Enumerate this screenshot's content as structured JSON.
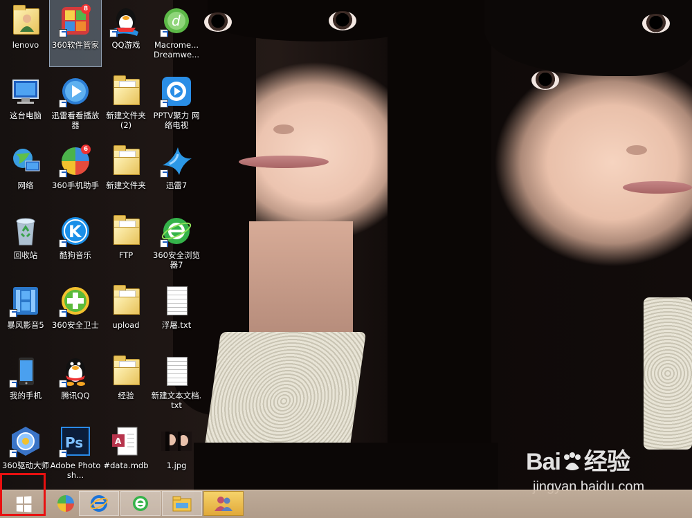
{
  "desktop": {
    "icons": [
      {
        "label": "lenovo",
        "icon": "user-folder-icon",
        "shortcut": false,
        "selected": false
      },
      {
        "label": "360软件管家",
        "icon": "360-software-manager-icon",
        "shortcut": true,
        "selected": true,
        "badge": "8"
      },
      {
        "label": "QQ游戏",
        "icon": "qq-game-icon",
        "shortcut": true,
        "selected": false
      },
      {
        "label": "Macrome... Dreamwe...",
        "icon": "dreamweaver-icon",
        "shortcut": true,
        "selected": false
      },
      {
        "label": "这台电脑",
        "icon": "computer-icon",
        "shortcut": false,
        "selected": false
      },
      {
        "label": "迅雷看看播放器",
        "icon": "xunlei-player-icon",
        "shortcut": true,
        "selected": false
      },
      {
        "label": "新建文件夹 (2)",
        "icon": "folder-icon",
        "shortcut": false,
        "selected": false
      },
      {
        "label": "PPTV聚力 网络电视",
        "icon": "pptv-icon",
        "shortcut": true,
        "selected": false
      },
      {
        "label": "网络",
        "icon": "network-icon",
        "shortcut": false,
        "selected": false
      },
      {
        "label": "360手机助手",
        "icon": "360-phone-assistant-icon",
        "shortcut": true,
        "selected": false,
        "badge": "6"
      },
      {
        "label": "新建文件夹",
        "icon": "folder-icon",
        "shortcut": false,
        "selected": false
      },
      {
        "label": "迅雷7",
        "icon": "xunlei-bird-icon",
        "shortcut": true,
        "selected": false
      },
      {
        "label": "回收站",
        "icon": "recycle-bin-icon",
        "shortcut": false,
        "selected": false
      },
      {
        "label": "酷狗音乐",
        "icon": "kugou-music-icon",
        "shortcut": true,
        "selected": false
      },
      {
        "label": "FTP",
        "icon": "folder-icon",
        "shortcut": false,
        "selected": false
      },
      {
        "label": "360安全浏览器7",
        "icon": "360-browser-icon",
        "shortcut": true,
        "selected": false
      },
      {
        "label": "暴风影音5",
        "icon": "baofeng-player-icon",
        "shortcut": true,
        "selected": false
      },
      {
        "label": "360安全卫士",
        "icon": "360-security-icon",
        "shortcut": true,
        "selected": false
      },
      {
        "label": "upload",
        "icon": "folder-icon",
        "shortcut": false,
        "selected": false
      },
      {
        "label": "浮屠.txt",
        "icon": "text-file-icon",
        "shortcut": false,
        "selected": false
      },
      {
        "label": "我的手机",
        "icon": "phone-icon",
        "shortcut": true,
        "selected": false
      },
      {
        "label": "腾讯QQ",
        "icon": "qq-penguin-icon",
        "shortcut": true,
        "selected": false
      },
      {
        "label": "经验",
        "icon": "folder-icon",
        "shortcut": false,
        "selected": false
      },
      {
        "label": "新建文本文档.txt",
        "icon": "text-file-icon",
        "shortcut": false,
        "selected": false
      },
      {
        "label": "360驱动大师",
        "icon": "360-driver-master-icon",
        "shortcut": true,
        "selected": false
      },
      {
        "label": "Adobe Photosh...",
        "icon": "photoshop-icon",
        "shortcut": true,
        "selected": false
      },
      {
        "label": "#data.mdb",
        "icon": "access-database-icon",
        "shortcut": false,
        "selected": false
      },
      {
        "label": "1.jpg",
        "icon": "image-thumbnail-icon",
        "shortcut": false,
        "selected": false
      }
    ]
  },
  "taskbar": {
    "start_icon": "windows-logo-icon",
    "items": [
      {
        "name": "pinwheel-app",
        "icon": "color-pinwheel-icon",
        "state": "normal"
      },
      {
        "name": "internet-explorer",
        "icon": "internet-explorer-icon",
        "state": "pinned"
      },
      {
        "name": "360-browser",
        "icon": "360-browser-icon",
        "state": "pinned"
      },
      {
        "name": "file-explorer",
        "icon": "file-explorer-icon",
        "state": "pinned"
      },
      {
        "name": "user-app",
        "icon": "users-icon",
        "state": "active"
      }
    ]
  },
  "watermark": {
    "brand_left": "Bai",
    "brand_right": "经验",
    "url": "jingyan.baidu.com"
  },
  "colors": {
    "highlight_box": "#e81010",
    "taskbar": "#c8b29c",
    "selection": "#aac8e6"
  }
}
